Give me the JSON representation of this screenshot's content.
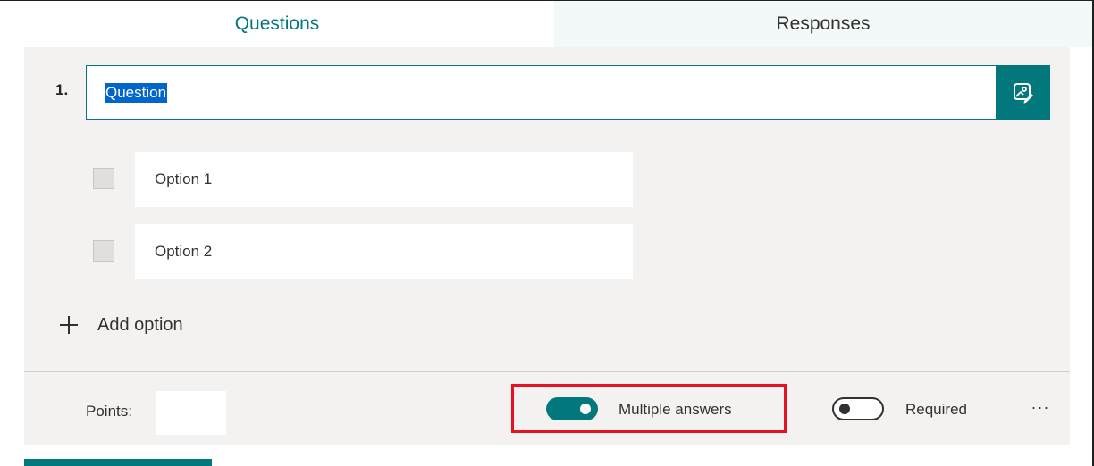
{
  "tabs": {
    "questions": "Questions",
    "responses": "Responses"
  },
  "question": {
    "number": "1.",
    "title": "Question",
    "options": [
      {
        "label": "Option 1",
        "checked": false
      },
      {
        "label": "Option 2",
        "checked": false
      }
    ],
    "add_option_label": "Add option",
    "image_button_icon": "insert-media-icon"
  },
  "footer": {
    "points_label": "Points:",
    "points_value": "",
    "multiple_answers": {
      "label": "Multiple answers",
      "on": true
    },
    "required": {
      "label": "Required",
      "on": false
    },
    "more_label": "···"
  },
  "colors": {
    "accent": "#03787c",
    "highlight": "#e81123",
    "selection": "#0066cc",
    "card_bg": "#f3f2f1"
  }
}
